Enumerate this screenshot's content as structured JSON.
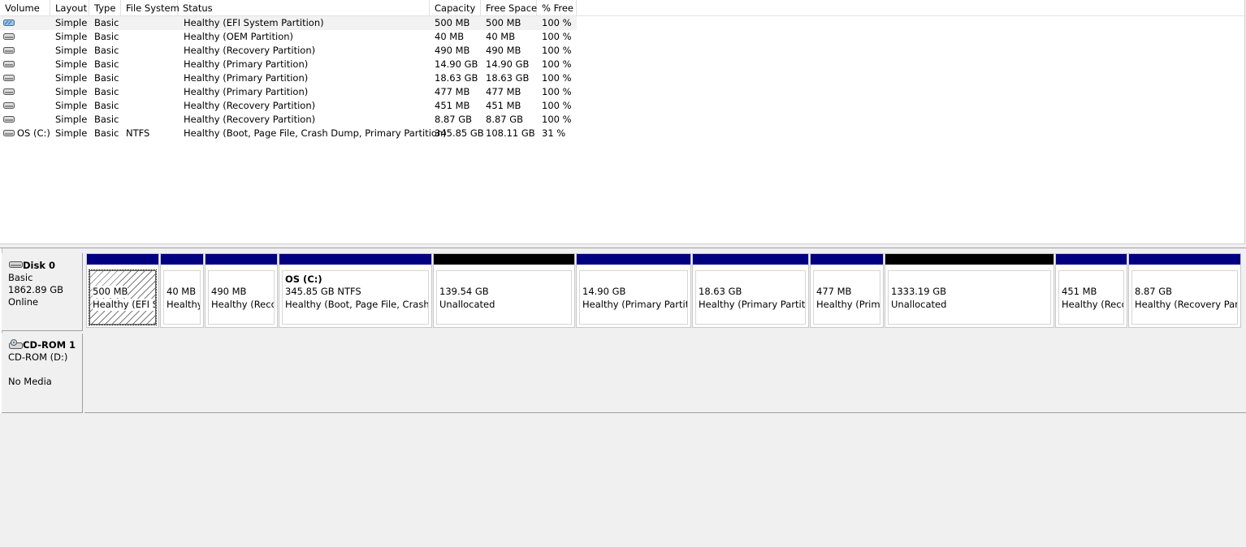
{
  "columns": [
    "Volume",
    "Layout",
    "Type",
    "File System",
    "Status",
    "Capacity",
    "Free Space",
    "% Free"
  ],
  "volumes": [
    {
      "volume": "",
      "layout": "Simple",
      "type": "Basic",
      "fs": "",
      "status": "Healthy (EFI System Partition)",
      "capacity": "500 MB",
      "free": "500 MB",
      "pct": "100 %",
      "icon": "volume-efi-icon"
    },
    {
      "volume": "",
      "layout": "Simple",
      "type": "Basic",
      "fs": "",
      "status": "Healthy (OEM Partition)",
      "capacity": "40 MB",
      "free": "40 MB",
      "pct": "100 %",
      "icon": "volume-disk-icon"
    },
    {
      "volume": "",
      "layout": "Simple",
      "type": "Basic",
      "fs": "",
      "status": "Healthy (Recovery Partition)",
      "capacity": "490 MB",
      "free": "490 MB",
      "pct": "100 %",
      "icon": "volume-disk-icon"
    },
    {
      "volume": "",
      "layout": "Simple",
      "type": "Basic",
      "fs": "",
      "status": "Healthy (Primary Partition)",
      "capacity": "14.90 GB",
      "free": "14.90 GB",
      "pct": "100 %",
      "icon": "volume-disk-icon"
    },
    {
      "volume": "",
      "layout": "Simple",
      "type": "Basic",
      "fs": "",
      "status": "Healthy (Primary Partition)",
      "capacity": "18.63 GB",
      "free": "18.63 GB",
      "pct": "100 %",
      "icon": "volume-disk-icon"
    },
    {
      "volume": "",
      "layout": "Simple",
      "type": "Basic",
      "fs": "",
      "status": "Healthy (Primary Partition)",
      "capacity": "477 MB",
      "free": "477 MB",
      "pct": "100 %",
      "icon": "volume-disk-icon"
    },
    {
      "volume": "",
      "layout": "Simple",
      "type": "Basic",
      "fs": "",
      "status": "Healthy (Recovery Partition)",
      "capacity": "451 MB",
      "free": "451 MB",
      "pct": "100 %",
      "icon": "volume-disk-icon"
    },
    {
      "volume": "",
      "layout": "Simple",
      "type": "Basic",
      "fs": "",
      "status": "Healthy (Recovery Partition)",
      "capacity": "8.87 GB",
      "free": "8.87 GB",
      "pct": "100 %",
      "icon": "volume-disk-icon"
    },
    {
      "volume": "OS (C:)",
      "layout": "Simple",
      "type": "Basic",
      "fs": "NTFS",
      "status": "Healthy (Boot, Page File, Crash Dump, Primary Partition)",
      "capacity": "345.85 GB",
      "free": "108.11 GB",
      "pct": "31 %",
      "icon": "volume-disk-icon"
    }
  ],
  "disk0": {
    "name": "Disk 0",
    "type": "Basic",
    "size": "1862.89 GB",
    "state": "Online",
    "partitions": [
      {
        "title": "",
        "line1": "500 MB",
        "line2": "Healthy (EFI Sy",
        "kind": "efi"
      },
      {
        "title": "",
        "line1": "40 MB",
        "line2": "Healthy",
        "kind": "primary"
      },
      {
        "title": "",
        "line1": "490 MB",
        "line2": "Healthy (Recov",
        "kind": "primary"
      },
      {
        "title": "OS  (C:)",
        "line1": "345.85 GB NTFS",
        "line2": "Healthy (Boot, Page File, Crash D",
        "kind": "primary"
      },
      {
        "title": "",
        "line1": "139.54 GB",
        "line2": "Unallocated",
        "kind": "unalloc"
      },
      {
        "title": "",
        "line1": "14.90 GB",
        "line2": "Healthy (Primary Partitic",
        "kind": "primary"
      },
      {
        "title": "",
        "line1": "18.63 GB",
        "line2": "Healthy (Primary Partitio",
        "kind": "primary"
      },
      {
        "title": "",
        "line1": "477 MB",
        "line2": "Healthy (Prima",
        "kind": "primary"
      },
      {
        "title": "",
        "line1": "1333.19 GB",
        "line2": "Unallocated",
        "kind": "unalloc"
      },
      {
        "title": "",
        "line1": "451 MB",
        "line2": "Healthy (Reco",
        "kind": "primary"
      },
      {
        "title": "",
        "line1": "8.87 GB",
        "line2": "Healthy (Recovery Parti",
        "kind": "primary"
      }
    ]
  },
  "cdrom": {
    "name": "CD-ROM 1",
    "drive": "CD-ROM (D:)",
    "media": "No Media"
  },
  "colors": {
    "primary_bar": "#000080",
    "unallocated_bar": "#000000"
  }
}
